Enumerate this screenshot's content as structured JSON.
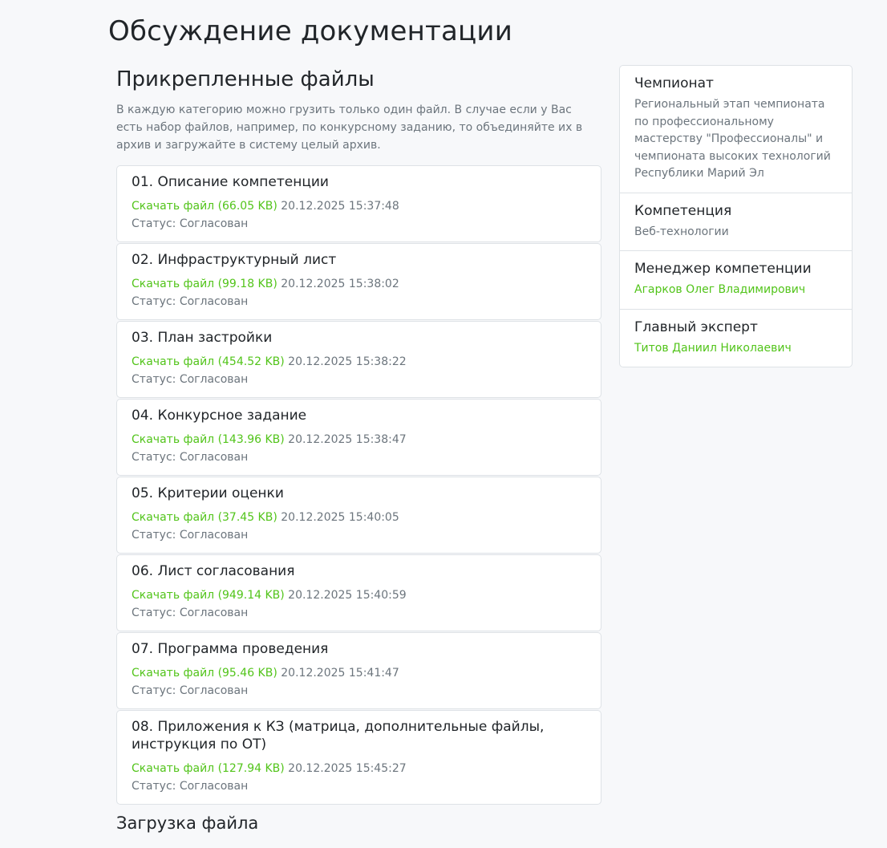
{
  "page": {
    "title": "Обсуждение документации"
  },
  "files_section": {
    "title": "Прикрепленные файлы",
    "description": "В каждую категорию можно грузить только один файл. В случае если у Вас есть набор файлов, например, по конкурсному заданию, то объединяйте их в архив и загружайте в систему целый архив.",
    "items": [
      {
        "title": "01. Описание компетенции",
        "download_label": "Скачать файл (66.05 KB)",
        "datetime": "20.12.2025 15:37:48",
        "status": "Статус: Согласован"
      },
      {
        "title": "02. Инфраструктурный лист",
        "download_label": "Скачать файл (99.18 KB)",
        "datetime": "20.12.2025 15:38:02",
        "status": "Статус: Согласован"
      },
      {
        "title": "03. План застройки",
        "download_label": "Скачать файл (454.52 KB)",
        "datetime": "20.12.2025 15:38:22",
        "status": "Статус: Согласован"
      },
      {
        "title": "04. Конкурсное задание",
        "download_label": "Скачать файл (143.96 KB)",
        "datetime": "20.12.2025 15:38:47",
        "status": "Статус: Согласован"
      },
      {
        "title": "05. Критерии оценки",
        "download_label": "Скачать файл (37.45 KB)",
        "datetime": "20.12.2025 15:40:05",
        "status": "Статус: Согласован"
      },
      {
        "title": "06. Лист согласования",
        "download_label": "Скачать файл (949.14 KB)",
        "datetime": "20.12.2025 15:40:59",
        "status": "Статус: Согласован"
      },
      {
        "title": "07. Программа проведения",
        "download_label": "Скачать файл (95.46 KB)",
        "datetime": "20.12.2025 15:41:47",
        "status": "Статус: Согласован"
      },
      {
        "title": "08. Приложения к КЗ (матрица, дополнительные файлы, инструкция по ОТ)",
        "download_label": "Скачать файл (127.94 KB)",
        "datetime": "20.12.2025 15:45:27",
        "status": "Статус: Согласован"
      }
    ]
  },
  "upload_section": {
    "title": "Загрузка файла"
  },
  "sidebar": {
    "championship": {
      "label": "Чемпионат",
      "value": "Региональный этап чемпионата по профессиональному мастерству \"Профессионалы\" и чемпионата высоких технологий Республики Марий Эл"
    },
    "competence": {
      "label": "Компетенция",
      "value": "Веб-технологии"
    },
    "manager": {
      "label": "Менеджер компетенции",
      "value": "Агарков Олег Владимирович"
    },
    "chief_expert": {
      "label": "Главный эксперт",
      "value": "Титов Даниил Николаевич"
    }
  },
  "colors": {
    "link": "#52c41a",
    "muted_text": "#6c757d",
    "background": "#f7f8fa"
  }
}
